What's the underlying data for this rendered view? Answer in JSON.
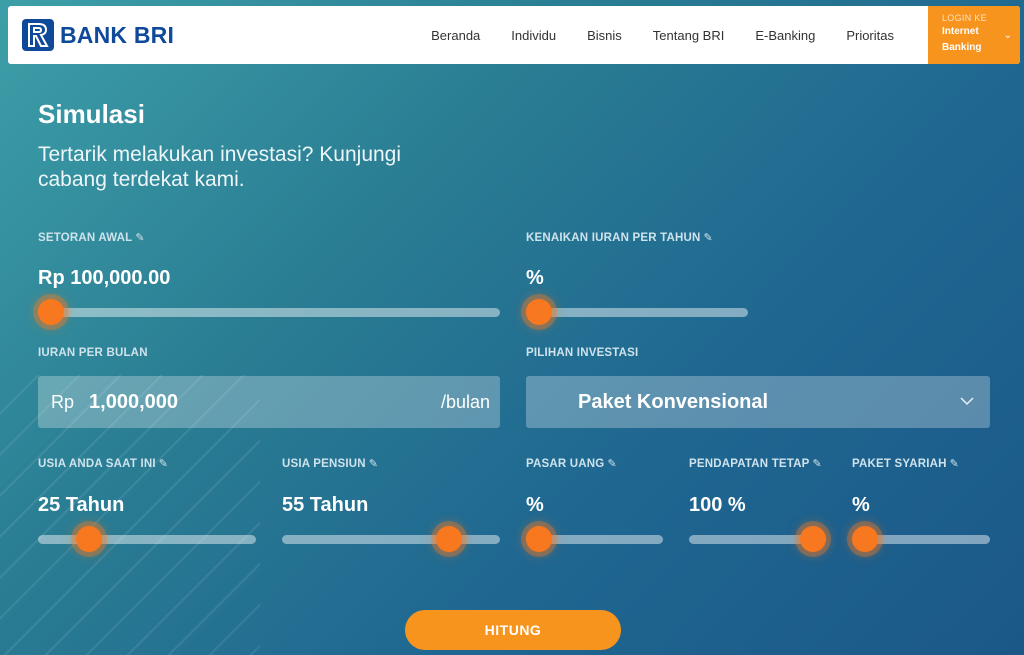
{
  "brand": {
    "name": "BANK BRI"
  },
  "nav": {
    "items": [
      "Beranda",
      "Individu",
      "Bisnis",
      "Tentang BRI",
      "E-Banking",
      "Prioritas"
    ],
    "login_small": "LOGIN KE",
    "login_big_1": "Internet",
    "login_big_2": "Banking"
  },
  "page": {
    "title": "Simulasi",
    "subtitle": "Tertarik melakukan investasi? Kunjungi cabang terdekat kami."
  },
  "form": {
    "setoran_awal": {
      "label": "SETORAN AWAL",
      "value": "Rp 100,000.00",
      "level": 0.0
    },
    "kenaikan": {
      "label": "KENAIKAN IURAN PER TAHUN",
      "value": "%",
      "level": 0.0
    },
    "iuran": {
      "label": "IURAN PER BULAN",
      "prefix": "Rp",
      "value": "1,000,000",
      "suffix": "/bulan"
    },
    "pilihan": {
      "label": "PILIHAN INVESTASI",
      "value": "Paket Konvensional"
    },
    "usia": {
      "label": "USIA ANDA SAAT INI",
      "value": "25 Tahun",
      "level": 0.2
    },
    "pensiun": {
      "label": "USIA PENSIUN",
      "value": "55 Tahun",
      "level": 0.8
    },
    "pasar_uang": {
      "label": "PASAR UANG",
      "value": "%",
      "level": 0.0
    },
    "pendapatan_tetap": {
      "label": "PENDAPATAN TETAP",
      "value": "100 %",
      "level": 1.0
    },
    "paket_syariah": {
      "label": "PAKET SYARIAH",
      "value": "%",
      "level": 0.0
    },
    "submit": "HITUNG"
  },
  "colors": {
    "accent": "#f7941d",
    "thumb": "#f7781f",
    "brand_blue": "#0f4a9a"
  }
}
